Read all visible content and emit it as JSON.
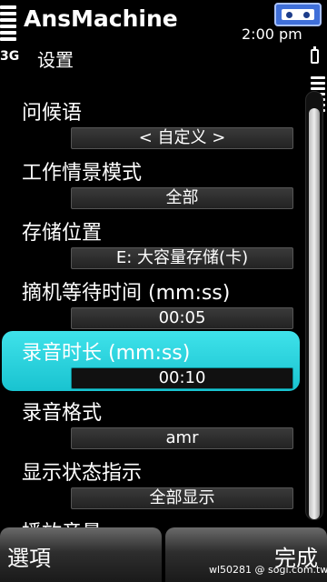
{
  "status": {
    "app_title": "AnsMachine",
    "network": "3G",
    "subtitle": "设置",
    "time": "2:00 pm"
  },
  "settings": [
    {
      "label": "问候语",
      "value": "< 自定义 >"
    },
    {
      "label": "工作情景模式",
      "value": "全部"
    },
    {
      "label": "存储位置",
      "value": "E: 大容量存储(卡)"
    },
    {
      "label": "摘机等待时间 (mm:ss)",
      "value": "00:05"
    },
    {
      "label": "录音时长 (mm:ss)",
      "value": "00:10"
    },
    {
      "label": "录音格式",
      "value": "amr"
    },
    {
      "label": "显示状态指示",
      "value": "全部显示"
    },
    {
      "label": "播放音量",
      "value": ""
    }
  ],
  "selected_index": 4,
  "softkeys": {
    "left": "選項",
    "right": "完成"
  },
  "watermark": "wl50281 @ sogi.com.tw",
  "colors": {
    "selection": "#1fd0dc",
    "background": "#000000",
    "tape_icon": "#3f6fd8"
  }
}
